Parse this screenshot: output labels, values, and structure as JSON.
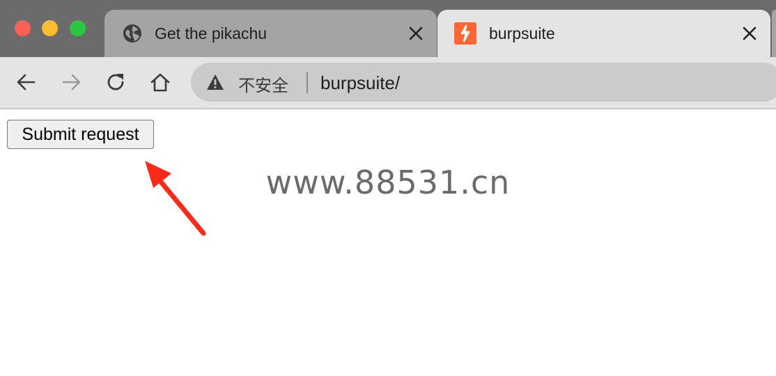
{
  "browser": {
    "tabs": [
      {
        "title": "Get the pikachu",
        "favicon": "globe-icon",
        "active": false
      },
      {
        "title": "burpsuite",
        "favicon": "burpsuite-icon",
        "active": true
      }
    ],
    "omnibox": {
      "security_label": "不安全",
      "url": "burpsuite/"
    }
  },
  "page": {
    "submit_label": "Submit request",
    "watermark": "www.88531.cn"
  },
  "colors": {
    "burp_orange": "#ff6633",
    "annotation_arrow": "#ff2a1a"
  }
}
